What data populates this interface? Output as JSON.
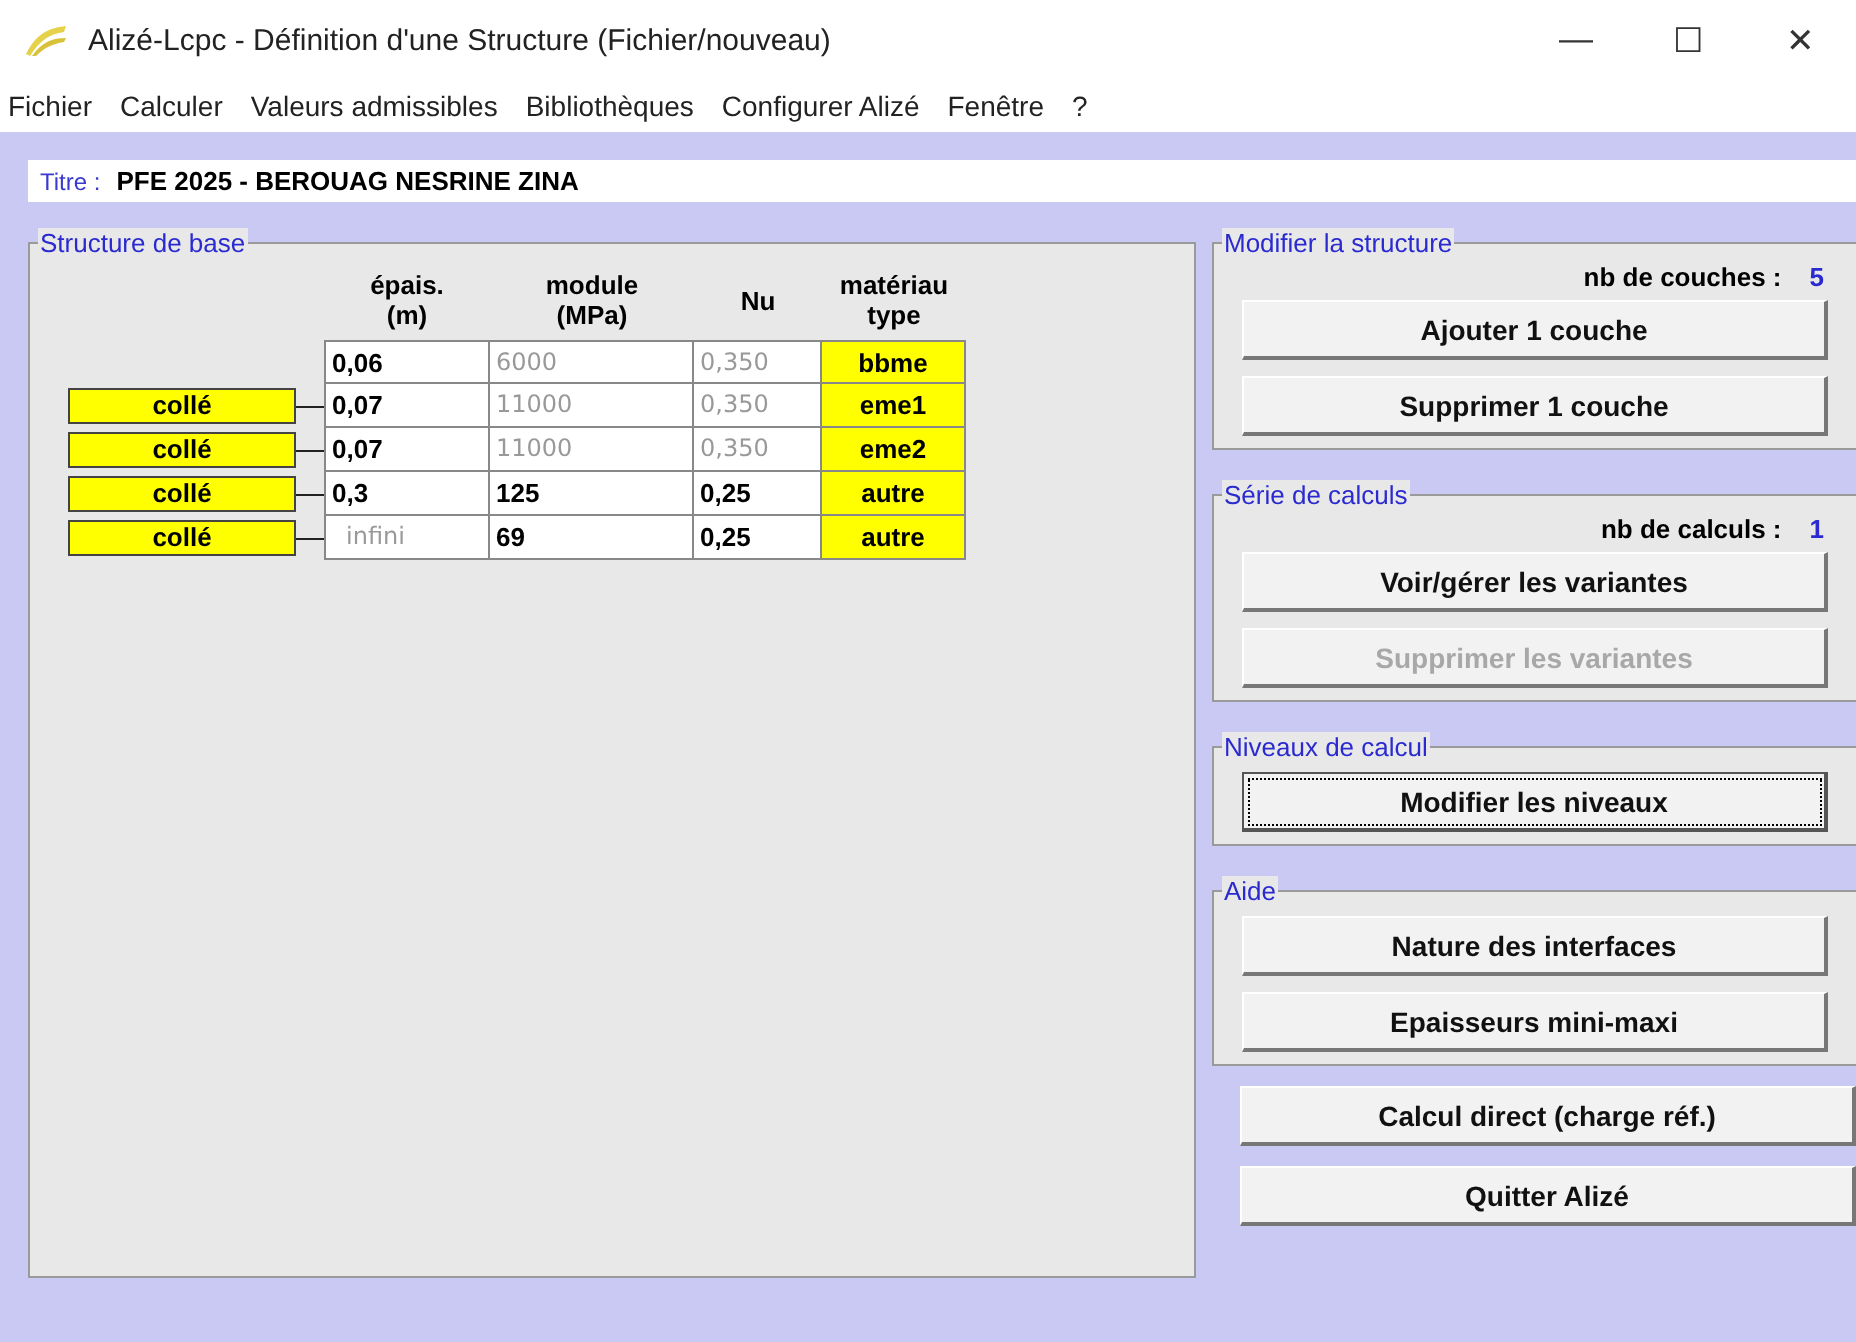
{
  "window": {
    "title": "Alizé-Lcpc - Définition d'une Structure (Fichier/nouveau)",
    "controls": [
      "—",
      "☐",
      "✕"
    ]
  },
  "menu": [
    "Fichier",
    "Calculer",
    "Valeurs admissibles",
    "Bibliothèques",
    "Configurer Alizé",
    "Fenêtre",
    "?"
  ],
  "title_field": {
    "label": "Titre :",
    "value": "PFE 2025 - BEROUAG NESRINE ZINA"
  },
  "structure": {
    "title": "Structure de base",
    "columns": [
      "épais.\n(m)",
      "module\n(MPa)",
      "Nu",
      "matériau\ntype"
    ],
    "layers": [
      {
        "thickness": {
          "text": "0,06",
          "muted": false
        },
        "modulus": {
          "text": "6000",
          "muted": true
        },
        "nu": {
          "text": "0,350",
          "muted": true
        },
        "material": "bbme"
      },
      {
        "thickness": {
          "text": "0,07",
          "muted": false
        },
        "modulus": {
          "text": "11000",
          "muted": true
        },
        "nu": {
          "text": "0,350",
          "muted": true
        },
        "material": "eme1"
      },
      {
        "thickness": {
          "text": "0,07",
          "muted": false
        },
        "modulus": {
          "text": "11000",
          "muted": true
        },
        "nu": {
          "text": "0,350",
          "muted": true
        },
        "material": "eme2"
      },
      {
        "thickness": {
          "text": "0,3",
          "muted": false
        },
        "modulus": {
          "text": "125",
          "muted": false
        },
        "nu": {
          "text": "0,25",
          "muted": false
        },
        "material": "autre"
      },
      {
        "thickness": {
          "text": "infini",
          "muted": true
        },
        "modulus": {
          "text": "69",
          "muted": false
        },
        "nu": {
          "text": "0,25",
          "muted": false
        },
        "material": "autre"
      }
    ],
    "interfaces": [
      "collé",
      "collé",
      "collé",
      "collé"
    ]
  },
  "groups": [
    {
      "title": "Modifier la structure",
      "count_label": "nb de couches :",
      "count": "5",
      "buttons": [
        {
          "label": "Ajouter 1 couche",
          "disabled": false,
          "focused": false
        },
        {
          "label": "Supprimer 1 couche",
          "disabled": false,
          "focused": false
        }
      ]
    },
    {
      "title": "Série de calculs",
      "count_label": "nb de calculs :",
      "count": "1",
      "buttons": [
        {
          "label": "Voir/gérer les variantes",
          "disabled": false,
          "focused": false
        },
        {
          "label": "Supprimer les variantes",
          "disabled": true,
          "focused": false
        }
      ]
    },
    {
      "title": "Niveaux de calcul",
      "buttons": [
        {
          "label": "Modifier les niveaux",
          "disabled": false,
          "focused": true
        }
      ]
    },
    {
      "title": "Aide",
      "buttons": [
        {
          "label": "Nature des interfaces",
          "disabled": false,
          "focused": false
        },
        {
          "label": "Epaisseurs mini-maxi",
          "disabled": false,
          "focused": false
        }
      ]
    }
  ],
  "actions": [
    {
      "label": "Calcul direct (charge réf.)",
      "disabled": false,
      "focused": false
    },
    {
      "label": "Quitter Alizé",
      "disabled": false,
      "focused": false
    }
  ]
}
